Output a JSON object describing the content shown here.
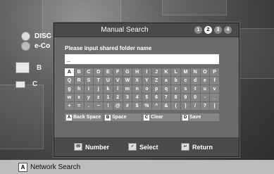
{
  "background_menu": {
    "items": [
      {
        "label": "DISC",
        "icon": "disc-icon"
      },
      {
        "label": "e-Co",
        "icon": "globe-icon"
      }
    ],
    "devices": [
      {
        "label": "B",
        "icon": "monitor-icon"
      },
      {
        "label": "C",
        "icon": "laptop-icon"
      }
    ]
  },
  "dialog": {
    "title": "Manual Search",
    "steps": [
      "1",
      "2",
      "3",
      "4"
    ],
    "active_step": "2",
    "prompt": "Please input shared folder name",
    "input_value": "_",
    "keyboard": [
      [
        "A",
        "B",
        "C",
        "D",
        "E",
        "F",
        "G",
        "H",
        "I",
        "J",
        "K",
        "L",
        "M",
        "N",
        "O",
        "P"
      ],
      [
        "Q",
        "R",
        "S",
        "T",
        "U",
        "V",
        "W",
        "X",
        "Y",
        "Z",
        "a",
        "b",
        "c",
        "d",
        "e",
        "f"
      ],
      [
        "g",
        "h",
        "i",
        "j",
        "k",
        "l",
        "m",
        "n",
        "o",
        "p",
        "q",
        "r",
        "s",
        "t",
        "u",
        "v"
      ],
      [
        "w",
        "x",
        "y",
        "z",
        "1",
        "2",
        "3",
        "4",
        "5",
        "6",
        "7",
        "8",
        "9",
        "0",
        "-",
        "_"
      ],
      [
        "+",
        "=",
        ".",
        "~",
        "!",
        "@",
        "#",
        "$",
        "%",
        "^",
        "&",
        "(",
        ")",
        "/",
        "?",
        "|"
      ]
    ],
    "selected_key": "A",
    "function_keys": [
      {
        "badge": "A",
        "label": "Back Space"
      },
      {
        "badge": "B",
        "label": "Space"
      },
      {
        "badge": "C",
        "label": "Clear"
      },
      {
        "badge": "D",
        "label": "Save"
      }
    ],
    "footer": [
      {
        "icon": "number-pad-icon",
        "label": "Number"
      },
      {
        "icon": "select-icon",
        "label": "Select"
      },
      {
        "icon": "return-icon",
        "label": "Return"
      }
    ]
  },
  "bottom_bar": {
    "badge": "A",
    "label": "Network Search"
  }
}
